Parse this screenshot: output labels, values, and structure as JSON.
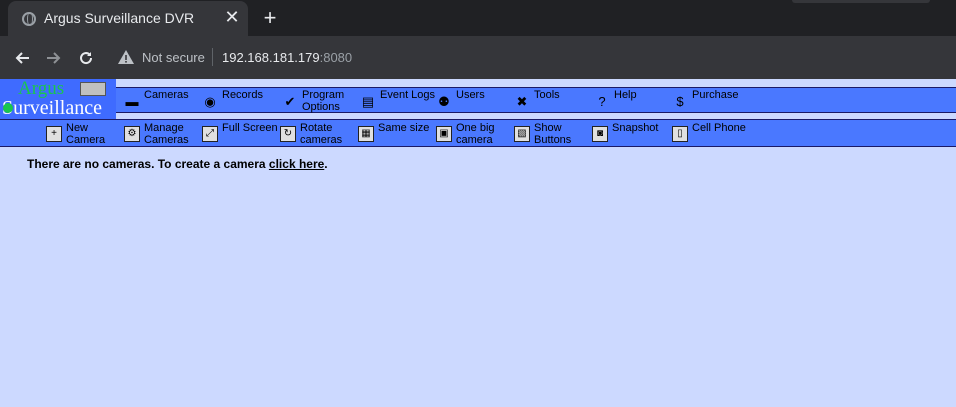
{
  "browser": {
    "tab_title": "Argus Surveillance DVR",
    "tab_close": "✕",
    "new_tab": "+",
    "not_secure": "Not secure",
    "url_host": "192.168.181.179",
    "url_port": ":8080"
  },
  "logo": {
    "line1": "Argus",
    "line2": "Surveillance"
  },
  "menu_main": [
    {
      "label": "Cameras",
      "icon": "▬"
    },
    {
      "label": "Records",
      "icon": "◉"
    },
    {
      "label": "Program Options",
      "icon": "✔"
    },
    {
      "label": "Event Logs",
      "icon": "▤"
    },
    {
      "label": "Users",
      "icon": "⚉"
    },
    {
      "label": "Tools",
      "icon": "✖"
    },
    {
      "label": "Help",
      "icon": "?"
    },
    {
      "label": "Purchase",
      "icon": "$"
    }
  ],
  "menu_sub": [
    {
      "label": "New Camera",
      "icon": "+"
    },
    {
      "label": "Manage Cameras",
      "icon": "⚙"
    },
    {
      "label": "Full Screen",
      "icon": "⤢"
    },
    {
      "label": "Rotate cameras",
      "icon": "↻"
    },
    {
      "label": "Same size",
      "icon": "▦"
    },
    {
      "label": "One big camera",
      "icon": "▣"
    },
    {
      "label": "Show Buttons",
      "icon": "▧"
    },
    {
      "label": "Snapshot",
      "icon": "◙"
    },
    {
      "label": "Cell Phone",
      "icon": "▯"
    }
  ],
  "message": {
    "text": "There are no cameras. To create a camera ",
    "link": "click here",
    "suffix": "."
  }
}
